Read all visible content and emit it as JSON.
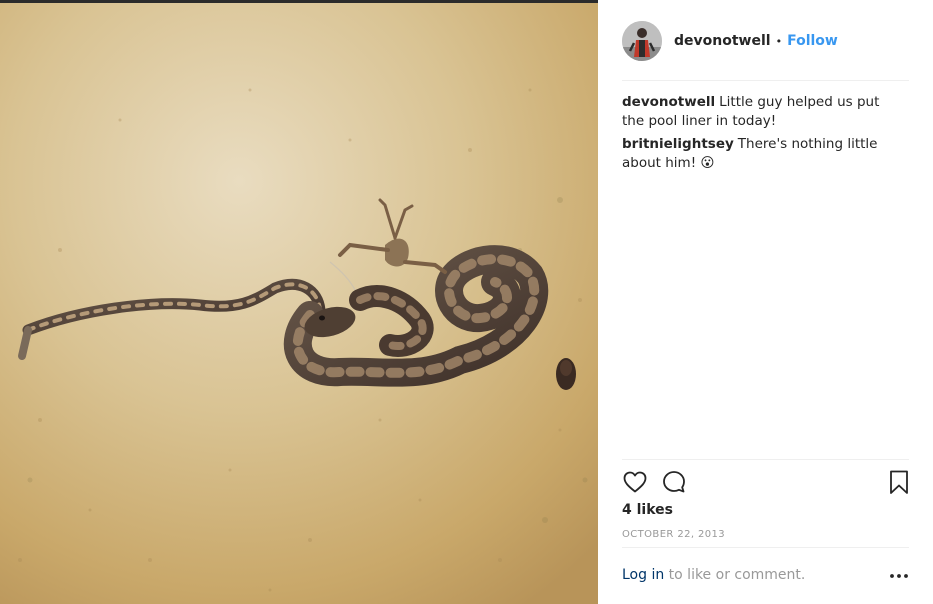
{
  "post": {
    "username": "devonotwell",
    "separator": "•",
    "follow_label": "Follow"
  },
  "comments": [
    {
      "author": "devonotwell",
      "text": "Little guy helped us put the pool liner in today!"
    },
    {
      "author": "britnielightsey",
      "text": "There's nothing little about him! 😮"
    }
  ],
  "likes_text": "4 likes",
  "date_text": "OCTOBER 22, 2013",
  "footer": {
    "login_label": "Log in",
    "suffix_text": " to like or comment."
  },
  "icons": {
    "like": "heart-icon",
    "comment": "comment-bubble-icon",
    "save": "bookmark-icon",
    "more": "more-options-icon"
  },
  "colors": {
    "follow_accent": "#3897f0",
    "login_link": "#003569",
    "muted_text": "#999999",
    "primary_text": "#262626",
    "divider": "#efefef"
  }
}
